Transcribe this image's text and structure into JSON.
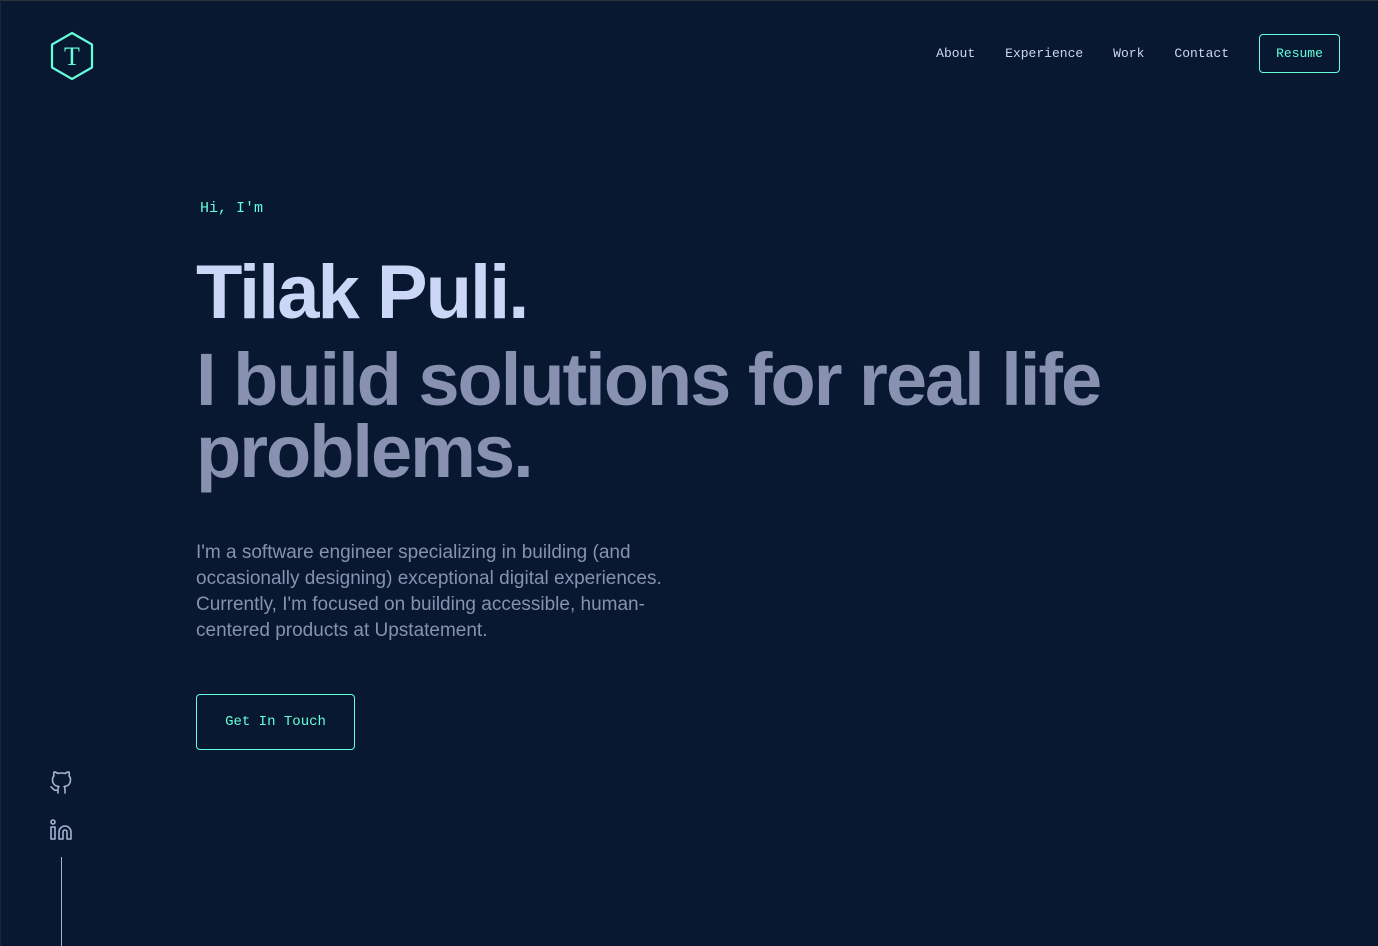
{
  "colors": {
    "background": "#071830",
    "accent": "#64ffda",
    "heading": "#ccd6f6",
    "muted": "#8892b0"
  },
  "logo": {
    "letter": "T",
    "icon": "hexagon-logo-icon"
  },
  "nav": {
    "items": [
      {
        "label": "About"
      },
      {
        "label": "Experience"
      },
      {
        "label": "Work"
      },
      {
        "label": "Contact"
      }
    ],
    "resume_label": "Resume"
  },
  "hero": {
    "greeting": "Hi, I'm",
    "name": "Tilak Puli.",
    "tagline": "I build solutions for real life problems.",
    "bio": "I'm a software engineer specializing in building (and occasionally designing) exceptional digital experiences. Currently, I'm focused on building accessible, human-centered products at Upstatement.",
    "cta_label": "Get In Touch"
  },
  "social": {
    "icons": [
      "github-icon",
      "linkedin-icon"
    ]
  }
}
